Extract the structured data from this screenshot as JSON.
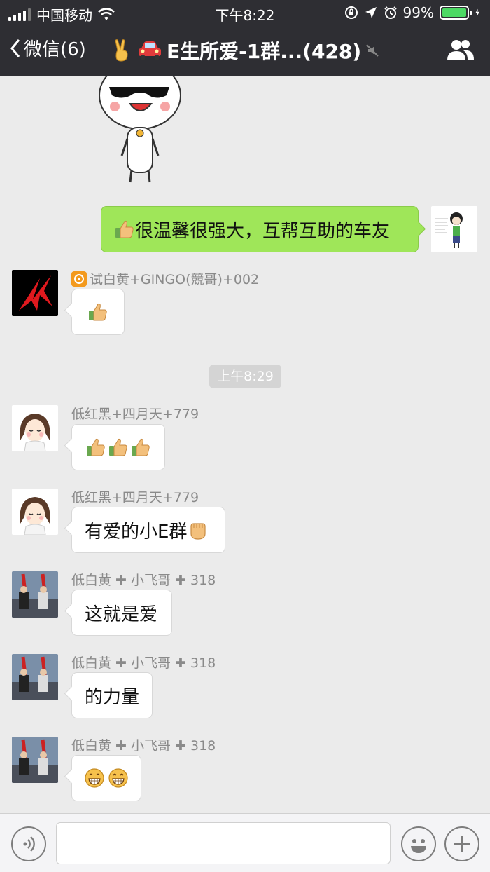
{
  "status_bar": {
    "carrier": "中国移动",
    "time": "下午8:22",
    "battery_percent": "99%",
    "battery_level": 0.99
  },
  "nav": {
    "back_label": "微信(6)",
    "title": "E生所爱-1群...(428)",
    "title_emojis": [
      "victory-hand",
      "car"
    ]
  },
  "messages": {
    "outgoing_1": {
      "text": "很温馨很强大，互帮互助的车友",
      "emoji": "thumbs-up"
    },
    "m1": {
      "sender": "试白黄+GINGO(競哥)+002",
      "sender_prefix_icon": "biohazard",
      "content": "thumbs-up"
    },
    "divider_time": "上午8:29",
    "m2": {
      "sender": "低红黑+四月天+779",
      "content": "thumbs-up x3"
    },
    "m3": {
      "sender": "低红黑+四月天+779",
      "text": "有爱的小E群",
      "emoji": "raised-fist"
    },
    "m4": {
      "sender": "低白黄 ✚ 小飞哥 ✚ 318",
      "text": "这就是爱"
    },
    "m5": {
      "sender": "低白黄 ✚ 小飞哥 ✚ 318",
      "text": "的力量"
    },
    "m6": {
      "sender": "低白黄 ✚ 小飞哥 ✚ 318",
      "content": "grin x2"
    }
  },
  "input_bar": {
    "voice_icon": "voice-icon",
    "emoji_icon": "emoji-icon",
    "add_icon": "plus-icon",
    "message_value": ""
  },
  "colors": {
    "nav_bg": "#2e2e33",
    "chat_bg": "#ebebeb",
    "outgoing_bubble": "#9fe659",
    "battery_fill": "#4cd964"
  }
}
